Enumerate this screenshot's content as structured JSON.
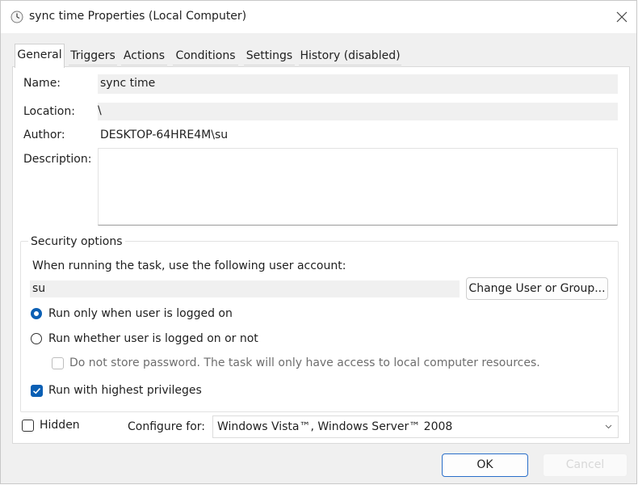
{
  "window": {
    "title": "sync time Properties (Local Computer)"
  },
  "tabs": [
    {
      "label": "General"
    },
    {
      "label": "Triggers"
    },
    {
      "label": "Actions"
    },
    {
      "label": "Conditions"
    },
    {
      "label": "Settings"
    },
    {
      "label": "History (disabled)"
    }
  ],
  "general": {
    "name_label": "Name:",
    "name_value": "sync time",
    "location_label": "Location:",
    "location_value": "\\",
    "author_label": "Author:",
    "author_value": "DESKTOP-64HRE4M\\su",
    "description_label": "Description:",
    "description_value": ""
  },
  "security": {
    "title": "Security options",
    "account_prompt": "When running the task, use the following user account:",
    "account_value": "su",
    "change_button": "Change User or Group...",
    "radio_logged_on": "Run only when user is logged on",
    "radio_whether": "Run whether user is logged on or not",
    "no_store_password": "Do not store password.  The task will only have access to local computer resources.",
    "highest_privileges": "Run with highest privileges",
    "selected_radio": "logged_on",
    "highest_privileges_checked": true,
    "no_store_password_checked": false
  },
  "footer": {
    "hidden_label": "Hidden",
    "hidden_checked": false,
    "configure_label": "Configure for:",
    "configure_value": "Windows Vista™, Windows Server™ 2008",
    "ok_button": "OK",
    "cancel_button": "Cancel"
  },
  "colors": {
    "accent": "#0a5fb4",
    "focus_border": "#2a6fc9"
  },
  "icons": {
    "title_icon": "clock-icon",
    "close": "close-icon",
    "combo_arrow": "chevron-down-icon"
  }
}
